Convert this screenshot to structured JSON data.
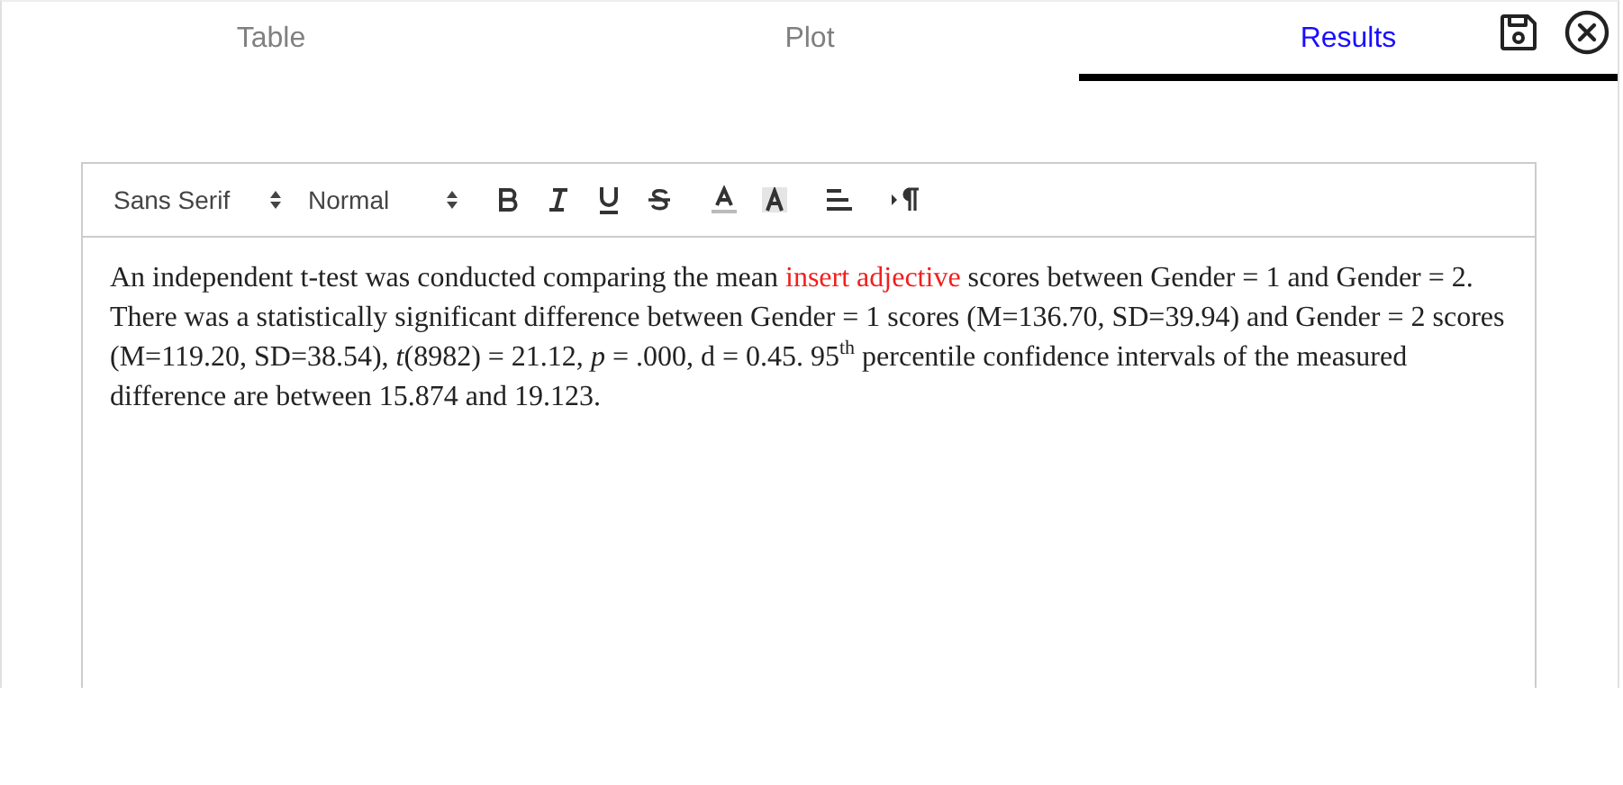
{
  "tabs": [
    {
      "label": "Table",
      "selected": false
    },
    {
      "label": "Plot",
      "selected": false
    },
    {
      "label": "Results",
      "selected": true
    }
  ],
  "toolbar": {
    "font": "Sans Serif",
    "size": "Normal"
  },
  "paragraph": [
    {
      "kind": "text",
      "text": "An independent t-test was conducted comparing the mean "
    },
    {
      "kind": "placeholder",
      "text": "insert adjective"
    },
    {
      "kind": "text",
      "text": " scores between Gender = 1 and Gender = 2. There was a statistically significant difference between Gender = 1 scores (M=136.70, SD=39.94) and Gender = 2 scores (M=119.20, SD=38.54), *t*(8982) = 21.12, *p* = .000, d = 0.45. 95$^{th}$ percentile confidence intervals of the measured difference are between 15.874 and 19.123."
    }
  ]
}
